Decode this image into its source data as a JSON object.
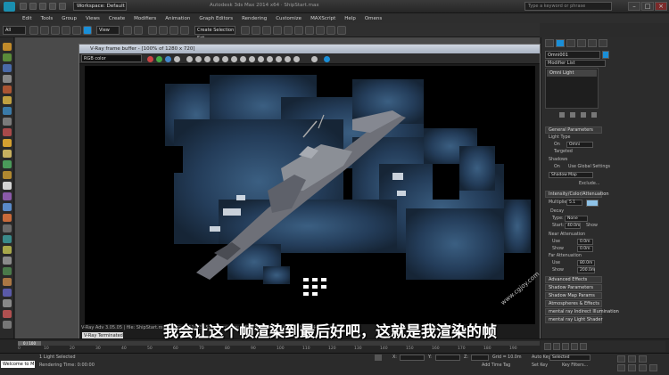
{
  "title_bar": {
    "workspace": "Workspace: Default",
    "window_title": "Autodesk 3ds Max 2014 x64 · ShipStart.max",
    "search_placeholder": "Type a keyword or phrase"
  },
  "menu": [
    "Edit",
    "Tools",
    "Group",
    "Views",
    "Create",
    "Modifiers",
    "Animation",
    "Graph Editors",
    "Rendering",
    "Customize",
    "MAXScript",
    "Help",
    "Omens"
  ],
  "toolbar": {
    "selection_filter": "All",
    "ref_coord": "View",
    "named_sel": "Create Selection Set"
  },
  "vfb": {
    "title": "V-Ray frame buffer - [100% of 1280 x 720]",
    "channel": "RGB color",
    "status": "V-Ray Adv 3.05.05 | file: ShipStart.max | frame: 11465152 | primitives: 12012585 | render time: 0h 0m 44.8s",
    "tab": "V-Ray Terminated"
  },
  "command_panel": {
    "object_name": "Omni001",
    "modifier_list": "Modifier List",
    "stack_item": "Omni Light",
    "general": {
      "header": "General Parameters",
      "light_type": "Light Type",
      "on_label": "On",
      "type_value": "Omni",
      "targeted": "Targeted",
      "shadows": "Shadows",
      "use_global": "Use Global Settings",
      "shadow_type": "Shadow Map",
      "exclude": "Exclude..."
    },
    "intensity": {
      "header": "Intensity/Color/Attenuation",
      "multiplier_label": "Multiplier:",
      "multiplier": "5.1",
      "decay": "Decay",
      "type_label": "Type:",
      "type_value": "None",
      "start_label": "Start:",
      "start_value": "40.0m",
      "show": "Show",
      "near": "Near Attenuation",
      "use": "Use",
      "near_start": "0.0m",
      "near_end": "0.0m",
      "far": "Far Attenuation",
      "far_start": "80.0m",
      "far_end": "200.0m"
    },
    "rollouts": [
      "Advanced Effects",
      "Shadow Parameters",
      "Shadow Map Params",
      "Atmospheres & Effects",
      "mental ray Indirect Illumination",
      "mental ray Light Shader"
    ]
  },
  "timeline": {
    "position": "0 / 100",
    "ticks": [
      "0",
      "10",
      "20",
      "30",
      "40",
      "50",
      "60",
      "70",
      "80",
      "90",
      "100",
      "110",
      "120",
      "130",
      "140",
      "150",
      "160",
      "170",
      "180",
      "190"
    ]
  },
  "status": {
    "listener": "Welcome to M",
    "selected": "1 Light Selected",
    "render_time": "Rendering Time: 0:00:00",
    "grid": "Grid = 10.0m",
    "add_time_tag": "Add Time Tag",
    "auto_key": "Auto Key",
    "set_key": "Set Key",
    "selected_label": "Selected",
    "key_filters": "Key Filters..."
  },
  "subtitle": "我会让这个帧渲染到最后好吧，这就是我渲染的帧",
  "watermark": "www.cgjoy.com",
  "colors": {
    "accent": "#1a8fd8",
    "swatch": "#8fc3e8"
  }
}
